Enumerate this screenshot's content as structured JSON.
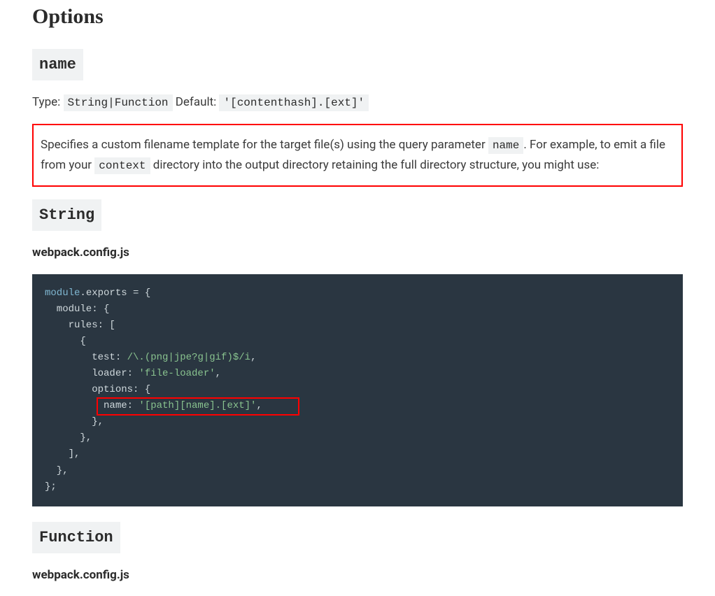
{
  "heading": "Options",
  "section_name": {
    "title": "name",
    "type_label": "Type:",
    "type_value": "String|Function",
    "default_label": "Default:",
    "default_value": "'[contenthash].[ext]'",
    "description_part1": "Specifies a custom filename template for the target file(s) using the query parameter ",
    "description_code1": "name",
    "description_part2": ". For example, to emit a file from your ",
    "description_code2": "context",
    "description_part3": " directory into the output directory retaining the full directory structure, you might use:"
  },
  "string_section": {
    "title": "String",
    "config_label": "webpack.config.js",
    "code": {
      "l1a": "module",
      "l1b": ".exports = {",
      "l2": "  module: {",
      "l3": "    rules: [",
      "l4": "      {",
      "l5a": "        test: ",
      "l5b": "/\\.(png|jpe?g|gif)$/i",
      "l5c": ",",
      "l6a": "        loader: ",
      "l6b": "'file-loader'",
      "l6c": ",",
      "l7": "        options: {",
      "l8a": "          name: ",
      "l8b": "'[path][name].[ext]'",
      "l8c": ",",
      "l9": "        },",
      "l10": "      },",
      "l11": "    ],",
      "l12": "  },",
      "l13": "};"
    }
  },
  "function_section": {
    "title": "Function",
    "config_label": "webpack.config.js"
  }
}
